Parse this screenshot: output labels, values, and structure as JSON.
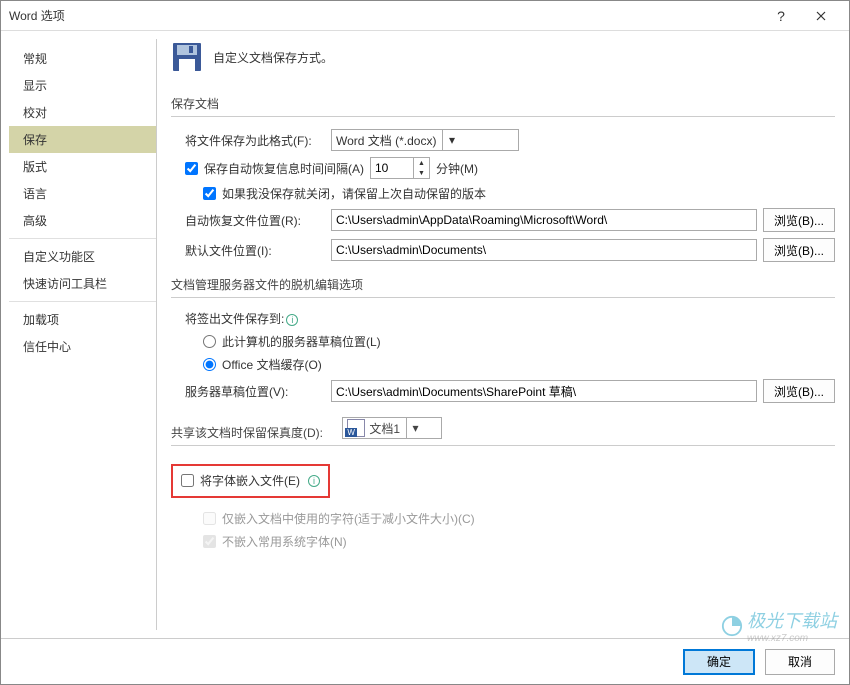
{
  "title": "Word 选项",
  "header_desc": "自定义文档保存方式。",
  "sidebar": {
    "items": [
      "常规",
      "显示",
      "校对",
      "保存",
      "版式",
      "语言",
      "高级",
      "自定义功能区",
      "快速访问工具栏",
      "加载项",
      "信任中心"
    ],
    "selected_index": 3
  },
  "section_save": {
    "title": "保存文档",
    "format_label": "将文件保存为此格式(F):",
    "format_value": "Word 文档 (*.docx)",
    "autosave_label": "保存自动恢复信息时间间隔(A)",
    "autosave_value": "10",
    "minutes": "分钟(M)",
    "keep_last_label": "如果我没保存就关闭，请保留上次自动保留的版本",
    "autorecover_loc_label": "自动恢复文件位置(R):",
    "autorecover_loc_value": "C:\\Users\\admin\\AppData\\Roaming\\Microsoft\\Word\\",
    "default_loc_label": "默认文件位置(I):",
    "default_loc_value": "C:\\Users\\admin\\Documents\\",
    "browse": "浏览(B)..."
  },
  "section_offline": {
    "title": "文档管理服务器文件的脱机编辑选项",
    "checkout_label": "将签出文件保存到:",
    "opt_server_drafts": "此计算机的服务器草稿位置(L)",
    "opt_office_cache": "Office 文档缓存(O)",
    "server_drafts_label": "服务器草稿位置(V):",
    "server_drafts_value": "C:\\Users\\admin\\Documents\\SharePoint 草稿\\",
    "browse": "浏览(B)..."
  },
  "section_fidelity": {
    "title": "共享该文档时保留保真度(D):",
    "doc_name": "文档1",
    "embed_fonts": "将字体嵌入文件(E)",
    "embed_used_only": "仅嵌入文档中使用的字符(适于减小文件大小)(C)",
    "no_common_fonts": "不嵌入常用系统字体(N)"
  },
  "footer": {
    "ok": "确定",
    "cancel": "取消"
  },
  "watermark": {
    "text": "极光下载站",
    "url": "www.xz7.com"
  }
}
